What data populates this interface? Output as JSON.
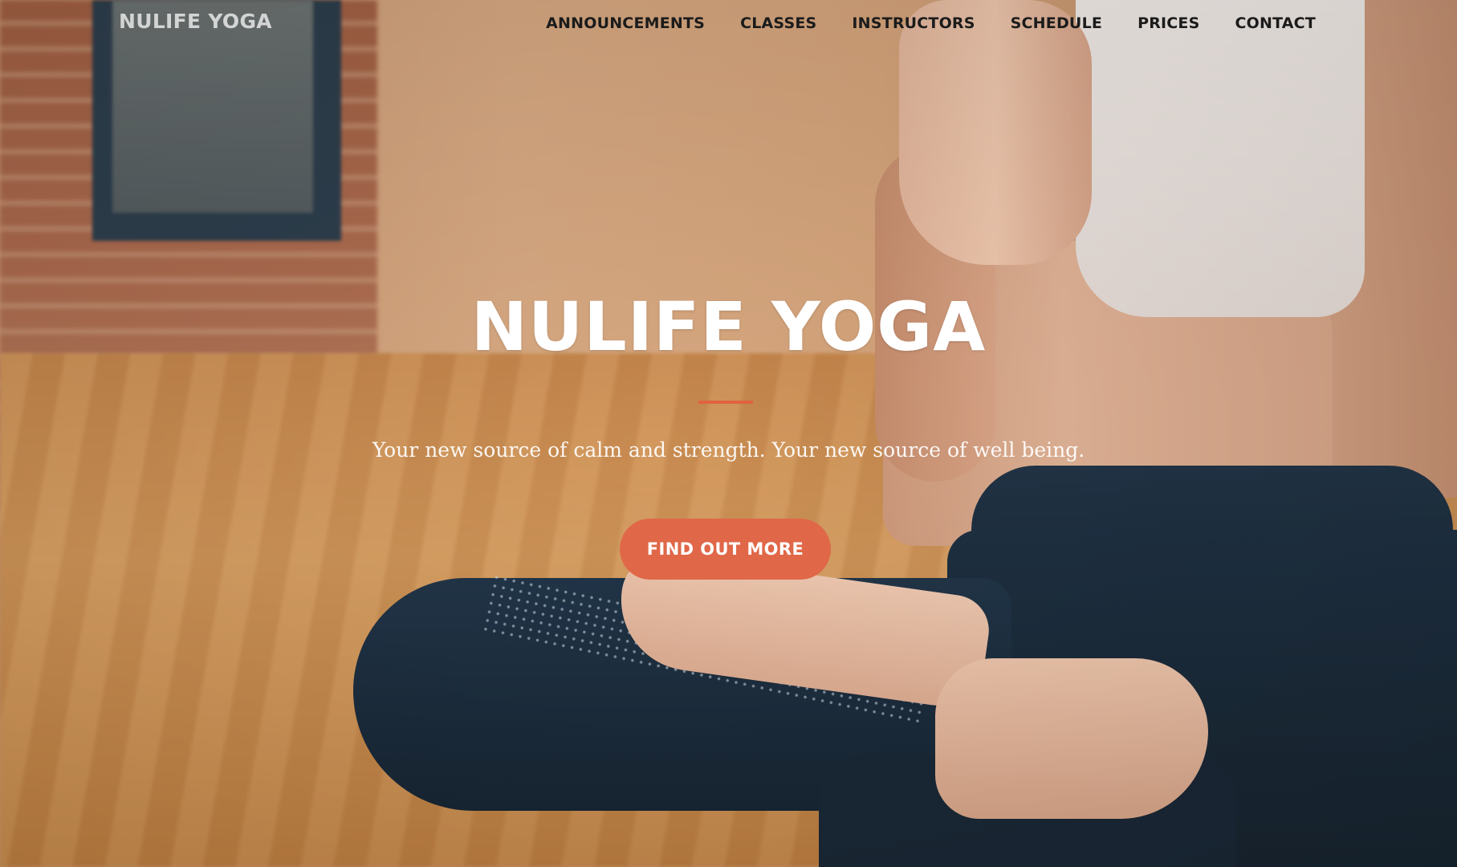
{
  "navbar": {
    "brand": "NULIFE YOGA",
    "links": [
      {
        "label": "ANNOUNCEMENTS"
      },
      {
        "label": "CLASSES"
      },
      {
        "label": "INSTRUCTORS"
      },
      {
        "label": "SCHEDULE"
      },
      {
        "label": "PRICES"
      },
      {
        "label": "CONTACT"
      }
    ]
  },
  "hero": {
    "title": "NULIFE YOGA",
    "subtitle": "Your new source of calm and strength. Your new source of well being.",
    "cta_label": "FIND OUT MORE"
  },
  "colors": {
    "accent": "#e06748",
    "divider": "#e0633f",
    "nav_text": "#1b1b1b",
    "hero_text": "#ffffff"
  }
}
